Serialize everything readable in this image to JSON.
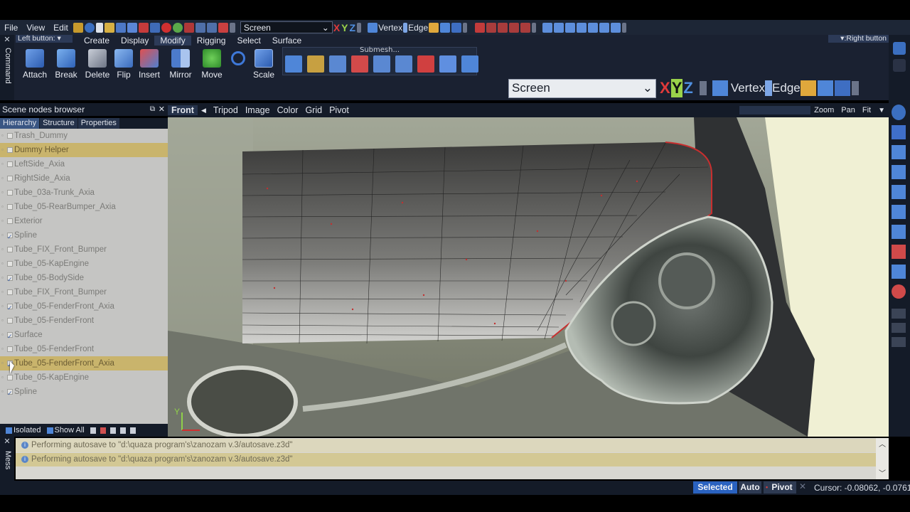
{
  "menu": [
    "File",
    "View",
    "Edit"
  ],
  "toolbar": {
    "view_select": "Screen",
    "axes": [
      "X",
      "Y",
      "Z"
    ],
    "vertex_label": "Vertex",
    "edge_label": "Edge",
    "left_button": "Left button:",
    "right_button": ":Right button"
  },
  "ribbon": {
    "tabs": [
      "Create",
      "Display",
      "Modify",
      "Rigging",
      "Select",
      "Surface"
    ],
    "buttons": [
      "Attach",
      "Break",
      "Delete",
      "Flip",
      "Insert",
      "Mirror",
      "Move",
      "",
      "Scale"
    ],
    "submesh_title": "Submesh..."
  },
  "command_strip": "Command",
  "viewport_selector": {
    "view": "Screen",
    "axes": [
      "X",
      "Y",
      "Z"
    ],
    "vertex": "Vertex",
    "edge": "Edge"
  },
  "scene_browser": {
    "title": "Scene nodes browser",
    "tabs": [
      "Hierarchy",
      "Structure",
      "Properties"
    ],
    "nodes": [
      {
        "label": "Trash_Dummy",
        "checked": false
      },
      {
        "label": "Dummy Helper",
        "checked": false
      },
      {
        "label": "LeftSide_Axia",
        "checked": false
      },
      {
        "label": "RightSide_Axia",
        "checked": false
      },
      {
        "label": "Tube_03a-Trunk_Axia",
        "checked": false
      },
      {
        "label": "Tube_05-RearBumper_Axia",
        "checked": false
      },
      {
        "label": "Exterior",
        "checked": false
      },
      {
        "label": "Spline",
        "checked": true
      },
      {
        "label": "Tube_FIX_Front_Bumper",
        "checked": false
      },
      {
        "label": "Tube_05-KapEngine",
        "checked": false
      },
      {
        "label": "Tube_05-BodySide",
        "checked": true
      },
      {
        "label": "Tube_FIX_Front_Bumper",
        "checked": false
      },
      {
        "label": "Tube_05-FenderFront_Axia",
        "checked": true
      },
      {
        "label": "Tube_05-FenderFront",
        "checked": false
      },
      {
        "label": "Surface",
        "checked": true
      },
      {
        "label": "Tube_05-FenderFront",
        "checked": false
      },
      {
        "label": "Tube_05-FenderFront_Axia",
        "checked": true
      },
      {
        "label": "Tube_05-KapEngine",
        "checked": false
      },
      {
        "label": "Spline",
        "checked": true
      }
    ],
    "footer": {
      "isolated": "Isolated",
      "show_all": "Show All"
    }
  },
  "viewport": {
    "menu": [
      "Front",
      "Tripod",
      "Image",
      "Color",
      "Grid",
      "Pivot"
    ],
    "controls": [
      "Zoom",
      "Pan",
      "Fit"
    ]
  },
  "messages": {
    "strip": "Mess",
    "lines": [
      "Performing autosave to \"d:\\quaza program's\\zanozam v.3/autosave.z3d\"",
      "Performing autosave to \"d:\\quaza program's\\zanozam v.3/autosave.z3d\""
    ]
  },
  "status": {
    "selected": "Selected",
    "auto": "Auto",
    "pivot": "Pivot",
    "cursor": "Cursor: -0.08062, -0.07613,"
  }
}
